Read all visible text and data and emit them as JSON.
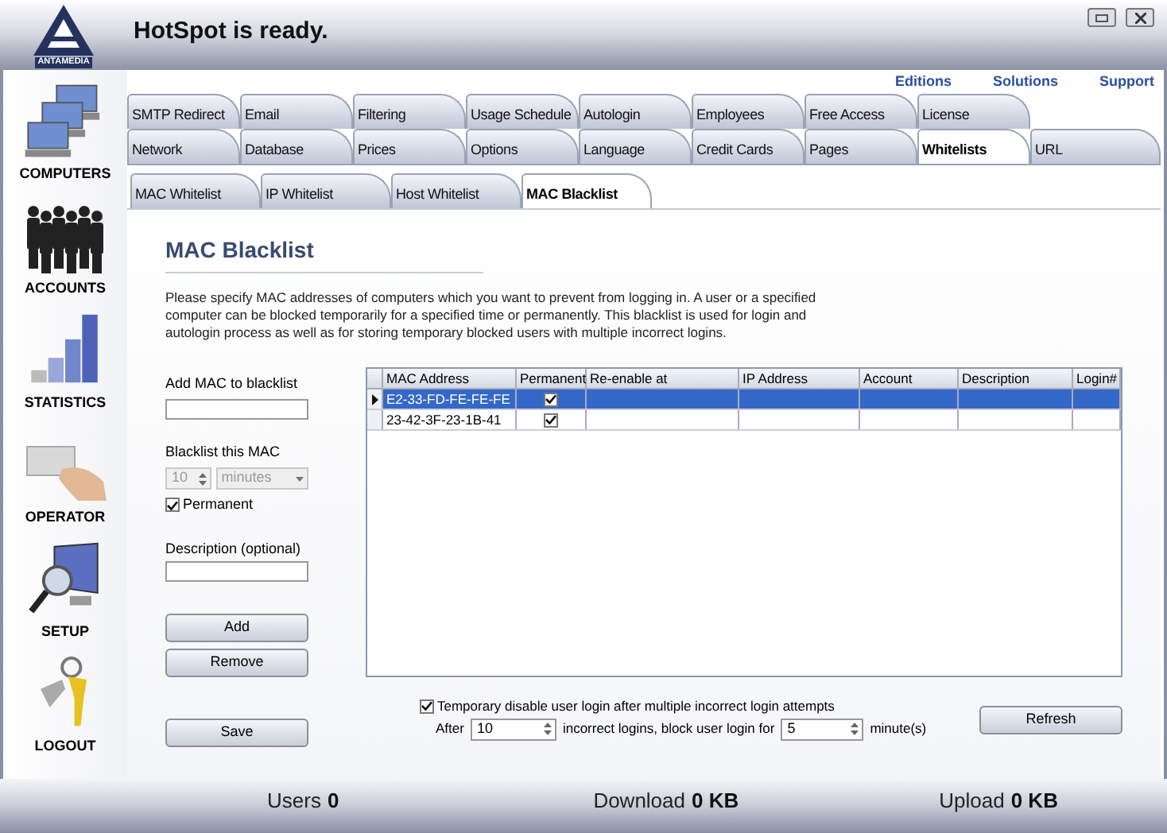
{
  "window": {
    "title": "HotSpot is ready.",
    "logo": "ANTAMEDIA"
  },
  "top_links": [
    "Editions",
    "Solutions",
    "Support"
  ],
  "sidebar": {
    "items": [
      {
        "label": "COMPUTERS",
        "kind": "computers"
      },
      {
        "label": "ACCOUNTS",
        "kind": "accounts"
      },
      {
        "label": "STATISTICS",
        "kind": "statistics"
      },
      {
        "label": "OPERATOR",
        "kind": "operator"
      },
      {
        "label": "SETUP",
        "kind": "setup"
      },
      {
        "label": "LOGOUT",
        "kind": "logout"
      }
    ]
  },
  "tabs_row1": [
    {
      "label": "SMTP Redirect",
      "selected": false
    },
    {
      "label": "Email",
      "selected": false
    },
    {
      "label": "Filtering",
      "selected": false
    },
    {
      "label": "Usage Schedule",
      "selected": false
    },
    {
      "label": "Autologin",
      "selected": false
    },
    {
      "label": "Employees",
      "selected": false
    },
    {
      "label": "Free Access",
      "selected": false
    },
    {
      "label": "License",
      "selected": false
    }
  ],
  "tabs_row2": [
    {
      "label": "Network",
      "selected": false
    },
    {
      "label": "Database",
      "selected": false
    },
    {
      "label": "Prices",
      "selected": false
    },
    {
      "label": "Options",
      "selected": false
    },
    {
      "label": "Language",
      "selected": false
    },
    {
      "label": "Credit Cards",
      "selected": false
    },
    {
      "label": "Pages",
      "selected": false
    },
    {
      "label": "Whitelists",
      "selected": true
    },
    {
      "label": "URL",
      "selected": false
    }
  ],
  "subtabs": [
    {
      "label": "MAC Whitelist",
      "selected": false
    },
    {
      "label": "IP Whitelist",
      "selected": false
    },
    {
      "label": "Host Whitelist",
      "selected": false
    },
    {
      "label": "MAC Blacklist",
      "selected": true
    }
  ],
  "section": {
    "title": "MAC Blacklist",
    "description": "Please specify MAC addresses of computers which you want to prevent from logging in. A user or a specified computer can be blocked temporarily for a specified time or permanently. This blacklist is used for login and autologin process as well as for storing temporary blocked users with multiple incorrect logins."
  },
  "form": {
    "add_label": "Add MAC to blacklist",
    "blacklist_label": "Blacklist this MAC",
    "duration": "10",
    "unit": "minutes",
    "duration_disabled": true,
    "permanent": {
      "label": "Permanent",
      "checked": true
    },
    "description_label": "Description (optional)",
    "buttons": [
      "Add",
      "Remove"
    ],
    "save": "Save"
  },
  "table": {
    "columns": [
      "MAC Address",
      "Permanent",
      "Re-enable at",
      "IP Address",
      "Account",
      "Description",
      "Login#"
    ],
    "rows": [
      {
        "selected": true,
        "mac": "E2-33-FD-FE-FE-FE",
        "permanent": true
      },
      {
        "selected": false,
        "mac": "23-42-3F-23-1B-41",
        "permanent": true
      }
    ]
  },
  "lockout": {
    "checked": true,
    "label": "Temporary disable user login after multiple incorrect login attempts",
    "after": "After",
    "attempts": "10",
    "middle": "incorrect logins, block user login for",
    "minutes": "5",
    "unit": "minute(s)"
  },
  "refresh": "Refresh",
  "status_bar": [
    {
      "label": "Users",
      "value": "0"
    },
    {
      "label": "Download",
      "value": "0 KB"
    },
    {
      "label": "Upload",
      "value": "0 KB"
    }
  ]
}
